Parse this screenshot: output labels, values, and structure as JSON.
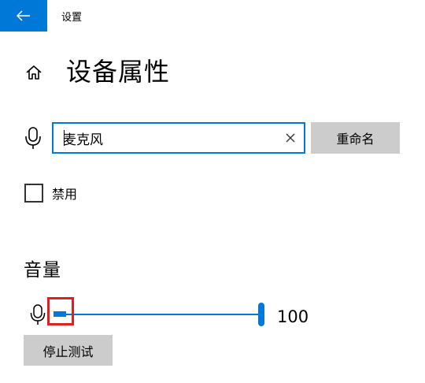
{
  "titlebar": {
    "title": "设置",
    "back_icon": "back-arrow-icon"
  },
  "page": {
    "title": "设备属性",
    "home_icon": "home-icon"
  },
  "device_name": {
    "icon": "microphone-icon",
    "value": "麦克风",
    "clear_icon": "clear-icon",
    "rename_label": "重命名"
  },
  "disable": {
    "label": "禁用",
    "checked": false
  },
  "volume": {
    "section_title": "音量",
    "icon": "microphone-icon",
    "value_text": "100",
    "value": 100,
    "min": 0,
    "max": 100,
    "input_level_percent": 6
  },
  "test": {
    "stop_label": "停止测试"
  },
  "colors": {
    "accent": "#0078d7",
    "button_bg": "#cccccc",
    "highlight": "#e02020"
  }
}
